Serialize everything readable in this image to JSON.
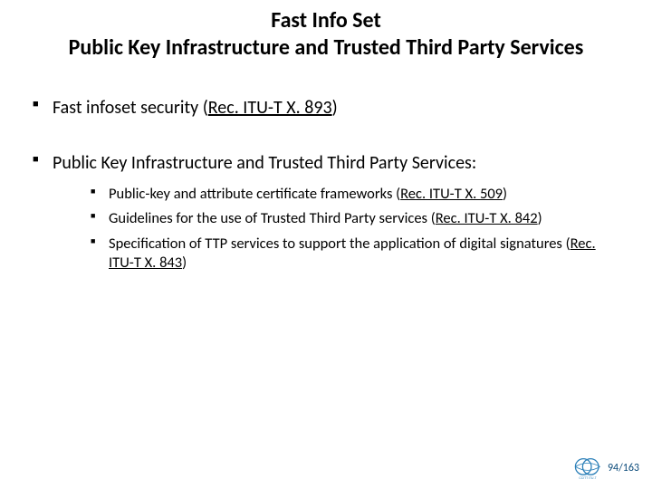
{
  "title": {
    "line1": "Fast Info Set",
    "line2": "Public Key Infrastructure and Trusted Third Party Services"
  },
  "items": [
    {
      "text_pre": "Fast infoset security (",
      "ref": "Rec. ITU-T X. 893",
      "text_post": ")"
    },
    {
      "text_pre": "Public Key Infrastructure and Trusted Third Party Services:",
      "ref": "",
      "text_post": "",
      "sub": [
        {
          "text_pre": "Public-key and attribute certificate frameworks (",
          "ref": "Rec. ITU-T X. 509",
          "text_post": ")"
        },
        {
          "text_pre": "Guidelines for the use of Trusted Third Party services (",
          "ref": "Rec. ITU-T X. 842",
          "text_post": ")"
        },
        {
          "text_pre": "Specification of TTP services to support the application of digital signatures (",
          "ref": "Rec. ITU-T X. 843",
          "text_post": ")"
        }
      ]
    }
  ],
  "footer": {
    "page": "94/163",
    "logo_label": "CCITT ITU-T 1956–2016"
  }
}
